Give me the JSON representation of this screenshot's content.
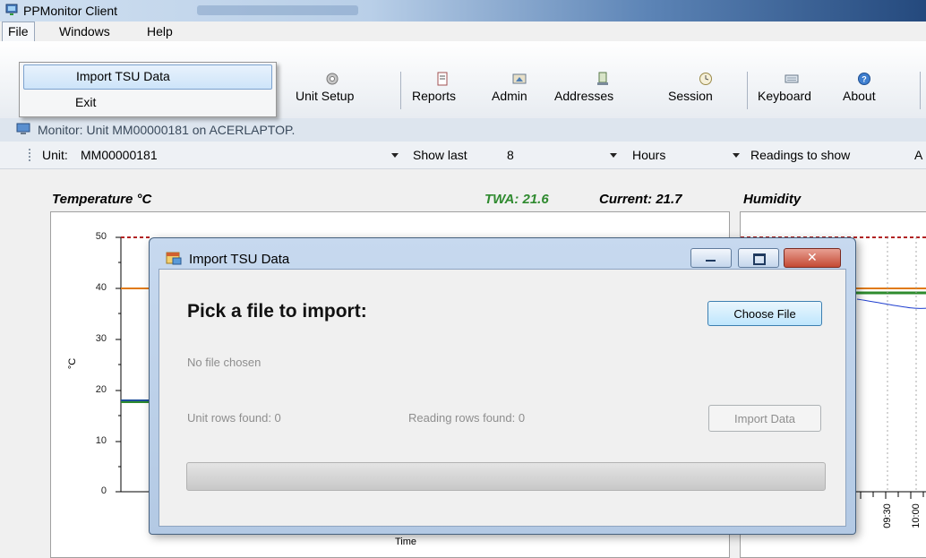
{
  "window": {
    "title": "PPMonitor Client"
  },
  "menubar": {
    "items": [
      "File",
      "Windows",
      "Help"
    ]
  },
  "file_menu": {
    "items": [
      "Import TSU Data",
      "Exit"
    ]
  },
  "toolbar": {
    "buttons": [
      "Unit Setup",
      "Reports",
      "Admin",
      "Addresses",
      "Session",
      "Keyboard",
      "About"
    ]
  },
  "monitor": {
    "label": "Monitor: Unit MM00000181 on ACERLAPTOP."
  },
  "filters": {
    "unit_label": "Unit:",
    "unit_value": "MM00000181",
    "show_last_label": "Show last",
    "show_last_value": "8",
    "period_value": "Hours",
    "readings_label": "Readings to show",
    "readings_value": "A"
  },
  "temperature_panel": {
    "title": "Temperature °C",
    "twa": "TWA: 21.6",
    "current": "Current: 21.7",
    "ylabel": "°C",
    "xlabel": "Time",
    "yticks": [
      "50",
      "40",
      "30",
      "20",
      "10",
      "0"
    ]
  },
  "humidity_panel": {
    "title": "Humidity",
    "xticks": [
      "09:30",
      "10:00"
    ]
  },
  "dialog": {
    "title": "Import TSU Data",
    "heading": "Pick a file to import:",
    "choose_button": "Choose File",
    "no_file": "No file chosen",
    "unit_rows": "Unit rows found: 0",
    "reading_rows": "Reading rows found: 0",
    "import_button": "Import Data"
  },
  "colors": {
    "upper_limit": "#e07a10",
    "lower_line": "#1f4e9a",
    "green_line": "#2e8b2e",
    "dashed_max": "#b22222",
    "twa_text": "#2f8a2f"
  }
}
